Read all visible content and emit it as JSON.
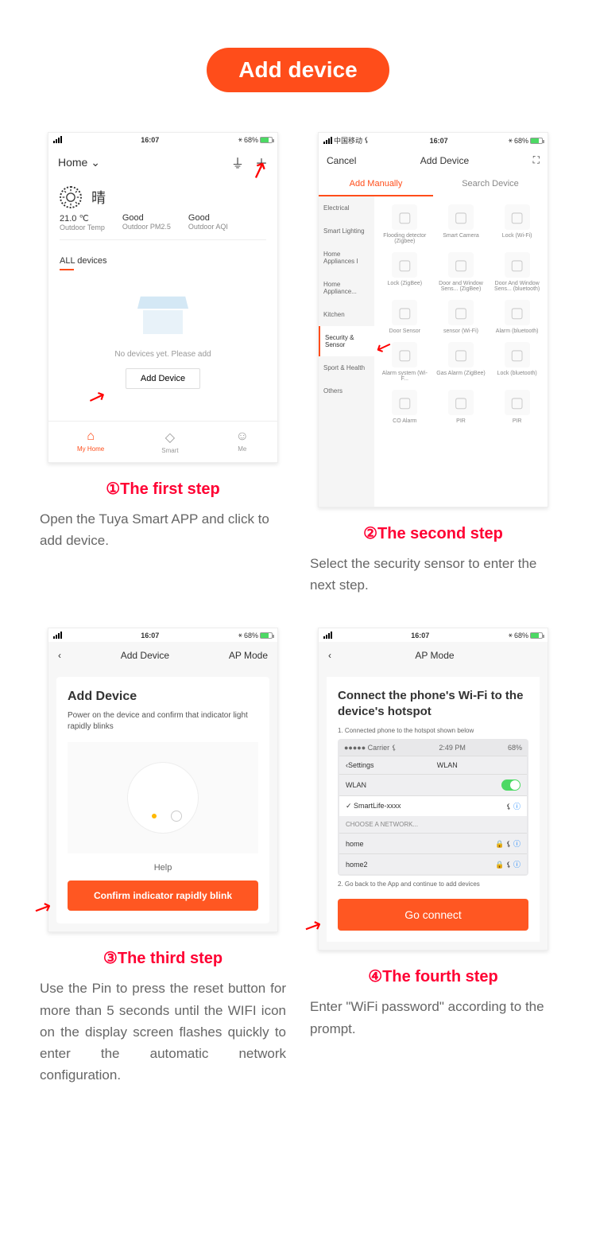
{
  "title": "Add device",
  "statusbar": {
    "carrier": "中国移动",
    "time": "16:07",
    "battery": "68%"
  },
  "screen1": {
    "home": "Home",
    "weather": "晴",
    "temp": "21.0 ℃",
    "temp_label": "Outdoor Temp",
    "pm": "Good",
    "pm_label": "Outdoor PM2.5",
    "aqi": "Good",
    "aqi_label": "Outdoor AQI",
    "all": "ALL devices",
    "empty": "No devices yet. Please add",
    "add": "Add Device",
    "tab1": "My Home",
    "tab2": "Smart",
    "tab3": "Me"
  },
  "screen2": {
    "cancel": "Cancel",
    "title": "Add Device",
    "tab1": "Add Manually",
    "tab2": "Search Device",
    "cats": [
      "Electrical",
      "Smart Lighting",
      "Home Appliances I",
      "Home Appliance...",
      "Kitchen",
      "Security & Sensor",
      "Sport & Health",
      "Others"
    ],
    "devs": [
      "Flooding detector (Zigbee)",
      "Smart Camera",
      "Lock (Wi-Fi)",
      "Lock (ZigBee)",
      "Door and Window Sens... (ZigBee)",
      "Door And Window Sens... (bluetooth)",
      "Door Sensor",
      "sensor (Wi-Fi)",
      "Alarm (bluetooth)",
      "Alarm system (Wi-F...",
      "Gas Alarm (ZigBee)",
      "Lock (bluetooth)",
      "CO Alarm",
      "PIR",
      "PIR"
    ]
  },
  "screen3": {
    "title": "Add Device",
    "mode": "AP Mode",
    "h": "Add Device",
    "p": "Power on the device and confirm that indicator light rapidly blinks",
    "help": "Help",
    "btn": "Confirm indicator rapidly blink"
  },
  "screen4": {
    "title": "AP Mode",
    "h": "Connect the phone's Wi-Fi to the device's hotspot",
    "s1": "1. Connected phone to the hotspot shown below",
    "s2": "2. Go back to the App and continue to add devices",
    "settings": "Settings",
    "wlan": "WLAN",
    "carrier_time": "2:49 PM",
    "carrier_batt": "68%",
    "net": "SmartLife-xxxx",
    "choose": "CHOOSE A NETWORK...",
    "n1": "home",
    "n2": "home2",
    "btn": "Go connect"
  },
  "steps": {
    "t1": "①The first step",
    "d1": "Open the Tuya Smart APP and click to add device.",
    "t2": "②The second step",
    "d2": "Select the security sensor to enter the next step.",
    "t3": "③The third step",
    "d3": "Use the Pin to press the reset button for more than 5 seconds until the WIFI icon on the display screen flashes quickly to enter the automatic network configuration.",
    "t4": "④The fourth step",
    "d4": "Enter \"WiFi password\" according to the prompt."
  }
}
